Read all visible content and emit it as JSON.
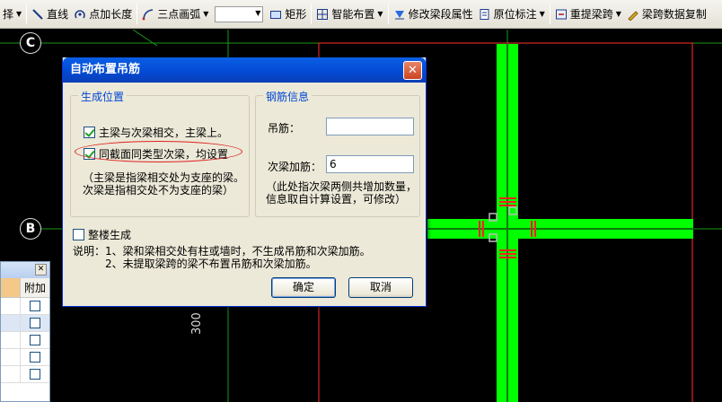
{
  "toolbar": {
    "items": [
      {
        "label": "择",
        "icon": "partial-left",
        "caret": true
      },
      {
        "label": "直线",
        "icon": "line-icon"
      },
      {
        "label": "点加长度",
        "icon": "point-length-icon"
      },
      {
        "label": "三点画弧",
        "icon": "arc-icon",
        "caret": true
      },
      {
        "label": "矩形",
        "icon": "rectangle-icon"
      },
      {
        "label": "智能布置",
        "icon": "smart-layout-icon",
        "caret": true
      },
      {
        "label": "修改梁段属性",
        "icon": "modify-beam-icon"
      },
      {
        "label": "原位标注",
        "icon": "in-situ-annotation-icon",
        "caret": true
      },
      {
        "label": "重提梁跨",
        "icon": "re-extract-span-icon",
        "caret": true
      },
      {
        "label": "梁跨数据复制",
        "icon": "copy-span-icon"
      }
    ]
  },
  "canvas": {
    "axis_c": "C",
    "axis_b": "B",
    "dimension": "300",
    "colors": {
      "beam": "#00ff00",
      "rebar": "#ff2020",
      "grid": "#1a9a1a",
      "border": "#ff3030"
    }
  },
  "side_panel": {
    "header": "附加",
    "rows": 5
  },
  "dialog": {
    "title": "自动布置吊筋",
    "close": "✕",
    "left_group": {
      "legend": "生成位置",
      "option1": "主梁与次梁相交，主梁上。",
      "option1_checked": true,
      "option2": "同截面同类型次梁，均设置",
      "option2_checked": true,
      "note_line1": "（主梁是指梁相交处为支座的梁。",
      "note_line2": "次梁是指相交处不为支座的梁）"
    },
    "right_group": {
      "legend": "钢筋信息",
      "hanger_label": "吊筋：",
      "hanger_value": "",
      "extra_label": "次梁加筋：",
      "extra_value": "6",
      "note_line1": "（此处指次梁两侧共增加数量，",
      "note_line2": "信息取自计算设置，可修改）"
    },
    "whole_floor": {
      "label": "整楼生成",
      "checked": false
    },
    "remark_line1": "说明：1、梁和梁相交处有柱或墙时，不生成吊筋和次梁加筋。",
    "remark_line2": "2、未提取梁跨的梁不布置吊筋和次梁加筋。",
    "ok": "确定",
    "cancel": "取消"
  }
}
